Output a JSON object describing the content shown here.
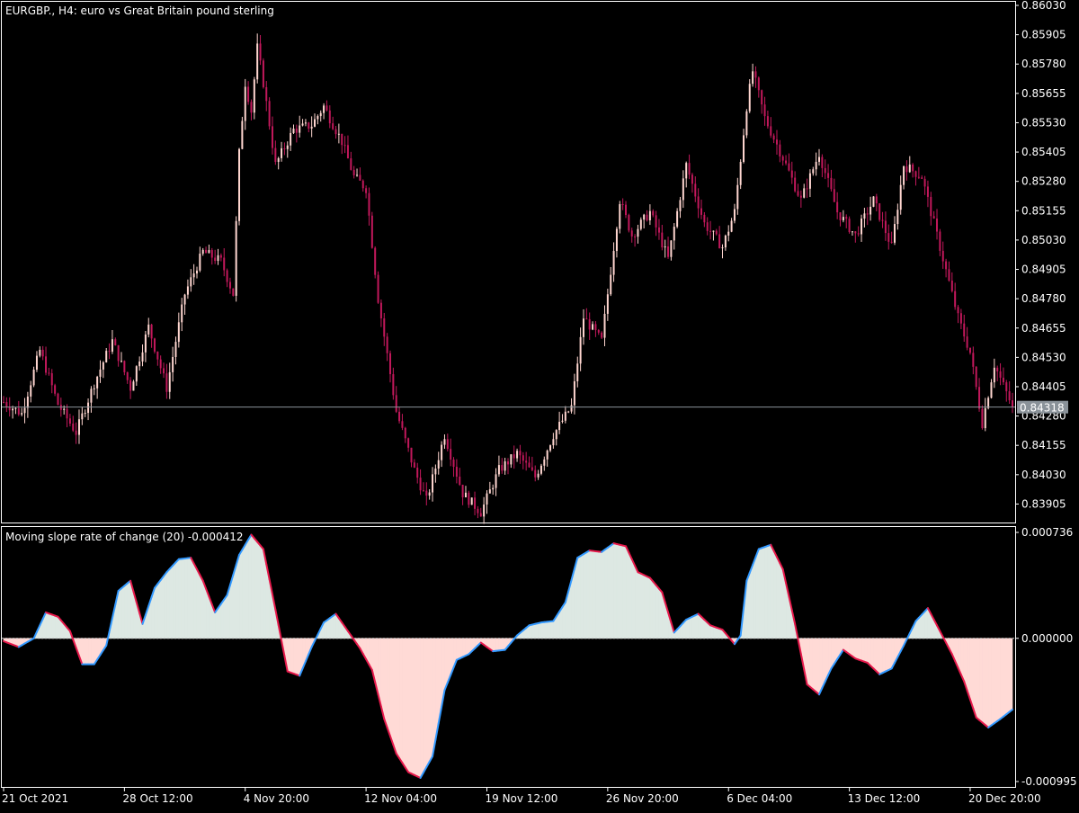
{
  "window": {
    "symbol_title": "EURGBP., H4:  euro vs Great Britain pound sterling",
    "current_price": "0.84318"
  },
  "indicator": {
    "title": "Moving slope rate of change (20) -0.000412"
  },
  "colors": {
    "background": "#000000",
    "frame": "#ffffff",
    "bull_candle": "#ffd6d0",
    "bear_candle": "#c2185b",
    "bid_line": "#8a9299",
    "price_label_bg": "#8a9299",
    "area_pos": "#dde8e3",
    "area_neg": "#ffdad6",
    "line_up": "#3399ff",
    "line_down": "#e6194b"
  },
  "chart_data": [
    {
      "type": "candlestick",
      "title": "EURGBP., H4:  euro vs Great Britain pound sterling",
      "y_ticks": [
        "0.86030",
        "0.85905",
        "0.85780",
        "0.85655",
        "0.85530",
        "0.85405",
        "0.85280",
        "0.85155",
        "0.85030",
        "0.84905",
        "0.84780",
        "0.84655",
        "0.84530",
        "0.84405",
        "0.84280",
        "0.84155",
        "0.84030",
        "0.83905"
      ],
      "ylim": [
        0.8383,
        0.8603
      ],
      "current_price": 0.84318,
      "x_ticks": [
        "21 Oct 2021",
        "28 Oct 12:00",
        "4 Nov 20:00",
        "12 Nov 04:00",
        "19 Nov 12:00",
        "26 Nov 20:00",
        "6 Dec 04:00",
        "13 Dec 12:00",
        "20 Dec 20:00"
      ],
      "x_tick_index": [
        0,
        40,
        80,
        120,
        160,
        200,
        240,
        280,
        320
      ],
      "bar_count": 335,
      "close_path": [
        [
          0,
          0.8434
        ],
        [
          6,
          0.8429
        ],
        [
          12,
          0.8456
        ],
        [
          18,
          0.8433
        ],
        [
          24,
          0.8421
        ],
        [
          30,
          0.8442
        ],
        [
          36,
          0.846
        ],
        [
          42,
          0.844
        ],
        [
          48,
          0.8466
        ],
        [
          54,
          0.844
        ],
        [
          60,
          0.848
        ],
        [
          66,
          0.8498
        ],
        [
          72,
          0.8494
        ],
        [
          76,
          0.848
        ],
        [
          78,
          0.854
        ],
        [
          80,
          0.857
        ],
        [
          82,
          0.8558
        ],
        [
          84,
          0.8585
        ],
        [
          86,
          0.857
        ],
        [
          90,
          0.8535
        ],
        [
          96,
          0.855
        ],
        [
          102,
          0.8552
        ],
        [
          106,
          0.856
        ],
        [
          112,
          0.8545
        ],
        [
          116,
          0.853
        ],
        [
          120,
          0.8525
        ],
        [
          124,
          0.8478
        ],
        [
          130,
          0.843
        ],
        [
          136,
          0.8405
        ],
        [
          140,
          0.8392
        ],
        [
          146,
          0.842
        ],
        [
          152,
          0.8395
        ],
        [
          158,
          0.8387
        ],
        [
          164,
          0.8405
        ],
        [
          170,
          0.8412
        ],
        [
          176,
          0.8402
        ],
        [
          182,
          0.842
        ],
        [
          188,
          0.8432
        ],
        [
          192,
          0.847
        ],
        [
          198,
          0.846
        ],
        [
          204,
          0.852
        ],
        [
          208,
          0.8505
        ],
        [
          214,
          0.8515
        ],
        [
          220,
          0.8495
        ],
        [
          226,
          0.8535
        ],
        [
          232,
          0.851
        ],
        [
          238,
          0.85
        ],
        [
          242,
          0.8515
        ],
        [
          246,
          0.856
        ],
        [
          248,
          0.8575
        ],
        [
          252,
          0.8555
        ],
        [
          258,
          0.8538
        ],
        [
          264,
          0.852
        ],
        [
          270,
          0.854
        ],
        [
          276,
          0.8515
        ],
        [
          282,
          0.8505
        ],
        [
          288,
          0.852
        ],
        [
          294,
          0.85
        ],
        [
          298,
          0.8535
        ],
        [
          304,
          0.853
        ],
        [
          310,
          0.85
        ],
        [
          316,
          0.847
        ],
        [
          320,
          0.8455
        ],
        [
          324,
          0.8425
        ],
        [
          328,
          0.845
        ],
        [
          334,
          0.84318
        ]
      ]
    },
    {
      "type": "area",
      "title": "Moving slope rate of change (20) -0.000412",
      "y_ticks": [
        "0.000736",
        "0.000000",
        "-0.000995"
      ],
      "ylim": [
        -0.000995,
        0.000736
      ],
      "zero_line": 0,
      "bar_count": 335,
      "path": [
        [
          0,
          -2e-05
        ],
        [
          5,
          -6e-05
        ],
        [
          10,
          0.0
        ],
        [
          14,
          0.00018
        ],
        [
          18,
          0.00015
        ],
        [
          22,
          5e-05
        ],
        [
          26,
          -0.00018
        ],
        [
          30,
          -0.00018
        ],
        [
          34,
          -5e-05
        ],
        [
          38,
          0.00033
        ],
        [
          42,
          0.0004
        ],
        [
          46,
          0.0001
        ],
        [
          50,
          0.00035
        ],
        [
          54,
          0.00046
        ],
        [
          58,
          0.00055
        ],
        [
          62,
          0.00056
        ],
        [
          66,
          0.0004
        ],
        [
          70,
          0.00018
        ],
        [
          74,
          0.0003
        ],
        [
          78,
          0.00058
        ],
        [
          82,
          0.00072
        ],
        [
          86,
          0.00062
        ],
        [
          90,
          0.0002
        ],
        [
          94,
          -0.00023
        ],
        [
          98,
          -0.00026
        ],
        [
          102,
          -6e-05
        ],
        [
          106,
          0.00011
        ],
        [
          110,
          0.00017
        ],
        [
          114,
          5e-05
        ],
        [
          118,
          -7e-05
        ],
        [
          122,
          -0.00022
        ],
        [
          126,
          -0.00056
        ],
        [
          130,
          -0.0008
        ],
        [
          134,
          -0.00093
        ],
        [
          138,
          -0.00097
        ],
        [
          142,
          -0.00082
        ],
        [
          146,
          -0.00036
        ],
        [
          150,
          -0.00015
        ],
        [
          154,
          -0.00011
        ],
        [
          158,
          -3e-05
        ],
        [
          162,
          -9e-05
        ],
        [
          166,
          -8e-05
        ],
        [
          170,
          2e-05
        ],
        [
          174,
          9e-05
        ],
        [
          178,
          0.00011
        ],
        [
          182,
          0.00012
        ],
        [
          186,
          0.00025
        ],
        [
          190,
          0.00056
        ],
        [
          194,
          0.00061
        ],
        [
          198,
          0.0006
        ],
        [
          202,
          0.00066
        ],
        [
          206,
          0.00064
        ],
        [
          210,
          0.00046
        ],
        [
          214,
          0.00042
        ],
        [
          218,
          0.00032
        ],
        [
          222,
          4e-05
        ],
        [
          226,
          0.00013
        ],
        [
          230,
          0.00017
        ],
        [
          234,
          9e-05
        ],
        [
          238,
          6e-05
        ],
        [
          242,
          -4e-05
        ],
        [
          244,
          2e-05
        ],
        [
          246,
          0.0004
        ],
        [
          250,
          0.00062
        ],
        [
          254,
          0.00065
        ],
        [
          258,
          0.00048
        ],
        [
          262,
          0.0001
        ],
        [
          266,
          -0.00032
        ],
        [
          270,
          -0.00039
        ],
        [
          274,
          -0.00021
        ],
        [
          278,
          -8e-05
        ],
        [
          282,
          -0.00014
        ],
        [
          286,
          -0.00017
        ],
        [
          290,
          -0.00025
        ],
        [
          294,
          -0.00021
        ],
        [
          298,
          -5e-05
        ],
        [
          302,
          0.00012
        ],
        [
          306,
          0.00021
        ],
        [
          310,
          5e-05
        ],
        [
          314,
          -0.00011
        ],
        [
          318,
          -0.0003
        ],
        [
          322,
          -0.00055
        ],
        [
          326,
          -0.00062
        ],
        [
          330,
          -0.00056
        ],
        [
          334,
          -0.000495
        ]
      ]
    }
  ]
}
